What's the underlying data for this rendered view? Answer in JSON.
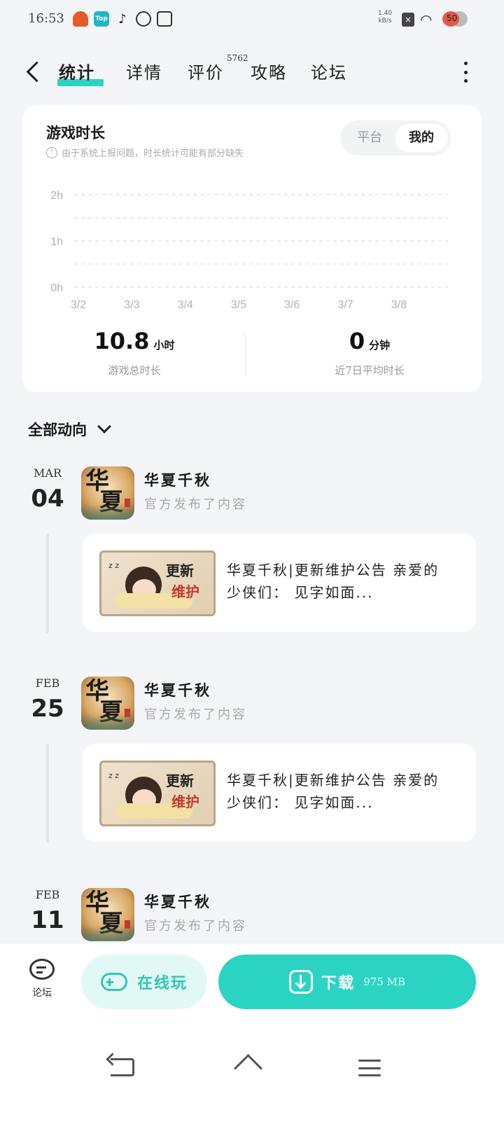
{
  "status_bar": {
    "time": "16:53",
    "net_speed_value": "1.40",
    "net_speed_unit": "kB/s",
    "battery": "50",
    "app_icons": [
      "game-app-icon",
      "top-app-icon",
      "tiktok-icon",
      "leaf-icon",
      "wallet-icon"
    ]
  },
  "nav": {
    "tabs": [
      "统计",
      "详情",
      "评价",
      "攻略",
      "论坛"
    ],
    "review_count": "5762",
    "active_tab": "统计"
  },
  "playtime": {
    "title": "游戏时长",
    "notice": "由于系统上报问题，时长统计可能有部分缺失",
    "segment": [
      "平台",
      "我的"
    ],
    "segment_selected": "我的",
    "total_value": "10.8",
    "total_unit": "小时",
    "total_label": "游戏总时长",
    "avg_value": "0",
    "avg_unit": "分钟",
    "avg_label": "近7日平均时长"
  },
  "chart_data": {
    "type": "bar",
    "categories": [
      "3/2",
      "3/3",
      "3/4",
      "3/5",
      "3/6",
      "3/7",
      "3/8"
    ],
    "values": [
      0,
      0,
      0,
      0,
      0,
      0,
      0
    ],
    "y_ticks": [
      "2h",
      "1h",
      "0h"
    ],
    "ylim": [
      0,
      2
    ],
    "grid": true
  },
  "feed": {
    "filter_label": "全部动向",
    "items": [
      {
        "month": "MAR",
        "day": "04",
        "game": "华夏千秋",
        "action": "官方发布了内容",
        "post": "华夏千秋|更新维护公告 亲爱的少侠们： 见字如面...",
        "thumb_line1": "更新",
        "thumb_line2": "维护"
      },
      {
        "month": "FEB",
        "day": "25",
        "game": "华夏千秋",
        "action": "官方发布了内容",
        "post": "华夏千秋|更新维护公告 亲爱的少侠们： 见字如面...",
        "thumb_line1": "更新",
        "thumb_line2": "维护"
      },
      {
        "month": "FEB",
        "day": "11",
        "game": "华夏千秋",
        "action": "官方发布了内容"
      }
    ],
    "icon_glyph_top": "华",
    "icon_glyph_bottom": "夏"
  },
  "bottom_bar": {
    "forum_label": "论坛",
    "play_label": "在线玩",
    "download_label": "下载",
    "download_size": "975 MB"
  },
  "colors": {
    "accent": "#2bd4c2",
    "accent_light": "#e2f8f5",
    "background": "#f3f5f8"
  }
}
